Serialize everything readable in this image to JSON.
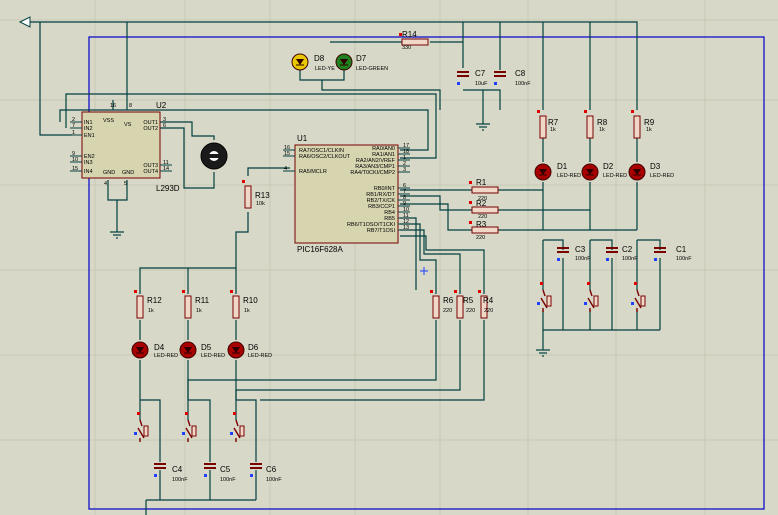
{
  "chips": {
    "u2": {
      "ref": "U2",
      "part": "L293D",
      "pins_left": [
        {
          "num": "2",
          "name": "IN1"
        },
        {
          "num": "7",
          "name": "IN2"
        },
        {
          "num": "1",
          "name": "EN1"
        },
        {
          "num": "9",
          "name": "EN2"
        },
        {
          "num": "10",
          "name": "IN3"
        },
        {
          "num": "15",
          "name": "IN4"
        }
      ],
      "pins_right": [
        {
          "num": "3",
          "name": "OUT1"
        },
        {
          "num": "6",
          "name": "OUT2"
        },
        {
          "num": "11",
          "name": "OUT3"
        },
        {
          "num": "14",
          "name": "OUT4"
        }
      ],
      "top_pins": [
        {
          "num": "16",
          "name": "VSS"
        },
        {
          "num": "8",
          "name": "VS"
        }
      ],
      "bottom_pins": [
        {
          "num": "4",
          "name": "GND"
        },
        {
          "num": "5",
          "name": "GND"
        },
        {
          "num": "12",
          "name": ""
        },
        {
          "num": "13",
          "name": ""
        }
      ]
    },
    "u1": {
      "ref": "U1",
      "part": "PIC16F628A",
      "pins_left": [
        {
          "num": "16",
          "name": "RA7/OSC1/CLKIN"
        },
        {
          "num": "15",
          "name": "RA6/OSC2/CLKOUT"
        },
        {
          "num": "4",
          "name": "RA5/MCLR"
        }
      ],
      "pins_right": [
        {
          "num": "17",
          "name": "RA0/AN0"
        },
        {
          "num": "18",
          "name": "RA1/AN1"
        },
        {
          "num": "1",
          "name": "RA2/AN2/VREF"
        },
        {
          "num": "2",
          "name": "RA3/AN3/CMP1"
        },
        {
          "num": "3",
          "name": "RA4/T0CKI/CMP2"
        },
        {
          "num": "6",
          "name": "RB0/INT"
        },
        {
          "num": "7",
          "name": "RB1/RX/DT"
        },
        {
          "num": "8",
          "name": "RB2/TX/CK"
        },
        {
          "num": "9",
          "name": "RB3/CCP1"
        },
        {
          "num": "10",
          "name": "RB4"
        },
        {
          "num": "11",
          "name": "RB5"
        },
        {
          "num": "12",
          "name": "RB6/T1OSO/T1CKI"
        },
        {
          "num": "13",
          "name": "RB7/T1OSI"
        }
      ]
    }
  },
  "resistors": [
    {
      "id": "R14",
      "value": "330"
    },
    {
      "id": "R13",
      "value": "10k"
    },
    {
      "id": "R7",
      "value": "1k"
    },
    {
      "id": "R8",
      "value": "1k"
    },
    {
      "id": "R9",
      "value": "1k"
    },
    {
      "id": "R1",
      "value": "220"
    },
    {
      "id": "R2",
      "value": "220"
    },
    {
      "id": "R3",
      "value": "220"
    },
    {
      "id": "R12",
      "value": "1k"
    },
    {
      "id": "R11",
      "value": "1k"
    },
    {
      "id": "R10",
      "value": "1k"
    },
    {
      "id": "R6",
      "value": "220"
    },
    {
      "id": "R5",
      "value": "220"
    },
    {
      "id": "R4",
      "value": "220"
    }
  ],
  "leds": [
    {
      "id": "D8",
      "value": "LED-YELLOW",
      "shown": "LED-YE"
    },
    {
      "id": "D7",
      "value": "LED-GREEN"
    },
    {
      "id": "D1",
      "value": "LED-RED"
    },
    {
      "id": "D2",
      "value": "LED-RED"
    },
    {
      "id": "D3",
      "value": "LED-RED"
    },
    {
      "id": "D4",
      "value": "LED-RED"
    },
    {
      "id": "D5",
      "value": "LED-RED"
    },
    {
      "id": "D6",
      "value": "LED-RED"
    }
  ],
  "capacitors": [
    {
      "id": "C7",
      "value": "10uF"
    },
    {
      "id": "C8",
      "value": "100nF"
    },
    {
      "id": "C3",
      "value": "100nF"
    },
    {
      "id": "C2",
      "value": "100nF"
    },
    {
      "id": "C1",
      "value": "100nF"
    },
    {
      "id": "C4",
      "value": "100nF"
    },
    {
      "id": "C5",
      "value": "100nF"
    },
    {
      "id": "C6",
      "value": "100nF"
    }
  ],
  "colors": {
    "background": "#d8d8c8",
    "wire": "#003f3f",
    "border": "#0000c8",
    "component": "#7a0000",
    "led": "#a80000"
  }
}
